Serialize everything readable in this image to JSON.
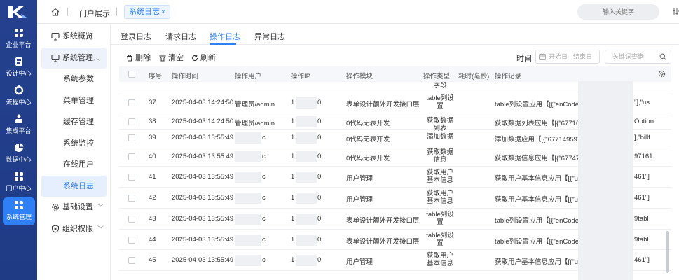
{
  "rail": {
    "items": [
      {
        "label": "企业平台",
        "icon": "grid-icon"
      },
      {
        "label": "设计中心",
        "icon": "design-icon"
      },
      {
        "label": "流程中心",
        "icon": "flow-icon"
      },
      {
        "label": "集成平台",
        "icon": "integration-icon"
      },
      {
        "label": "数据中心",
        "icon": "pie-icon"
      },
      {
        "label": "门户中心",
        "icon": "portal-icon"
      },
      {
        "label": "系统管理",
        "icon": "system-icon"
      }
    ]
  },
  "topbar": {
    "portal_tab": "门户展示",
    "active_tab": "系统日志",
    "close_glyph": "×",
    "search_placeholder": "输入关键字"
  },
  "sidebar": {
    "overview": "系统概览",
    "manage": "系统管理",
    "sub": [
      "系统参数",
      "菜单管理",
      "缓存管理",
      "系统监控",
      "在线用户",
      "系统日志"
    ],
    "basic": "基础设置",
    "org": "组织权限"
  },
  "tabs": [
    "登录日志",
    "请求日志",
    "操作日志",
    "异常日志"
  ],
  "active_tab_index": 2,
  "toolbar": {
    "delete": "删除",
    "clear": "清空",
    "refresh": "刷新",
    "time_label": "时间:",
    "date_placeholder": "开始日 - 结束日",
    "keyword_placeholder": "关键词查询"
  },
  "table": {
    "headers": [
      "序号",
      "操作时间",
      "操作用户",
      "操作IP",
      "操作模块",
      "操作类型",
      "耗时(毫秒)",
      "操作记录"
    ],
    "partial_top_type": "字段",
    "rows": [
      {
        "no": "37",
        "time": "2025-04-03 14:24:50",
        "user": "管理员/admin",
        "ip_a": "1",
        "ip_b": "0",
        "module": "表单设计额外开发接口层",
        "type": "table列设置",
        "record_a": "table列设置应用【[{\"enCode\":\"li",
        "record_b": "\"],\"us"
      },
      {
        "no": "38",
        "time": "2025-04-03 14:24:50",
        "user": "管理员/admin",
        "ip_a": "1",
        "ip_b": "0",
        "module": "0代码无表开发",
        "type": "获取数据列表",
        "record_a": "获取数据列表应用【[{\"677167235",
        "record_b": "Option"
      },
      {
        "no": "39",
        "time": "2025-04-03 13:55:49",
        "user": "",
        "user_tail": "c",
        "ip_a": "1",
        "ip_b": "0",
        "module": "0代码无表开发",
        "type": "添加数据",
        "record_a": "添加数据应用【[{\"6771495971635",
        "record_b": "],\"billf"
      },
      {
        "no": "40",
        "time": "2025-04-03 13:55:49",
        "user": "",
        "user_tail": "c",
        "ip_a": "1",
        "ip_b": "0",
        "module": "0代码无表开发",
        "type": "获取数据信息",
        "record_a": "获取数据信息应用【[{\"67747802",
        "record_b": "97161"
      },
      {
        "no": "41",
        "time": "2025-04-03 13:55:49",
        "user": "",
        "user_tail": "c",
        "ip_a": "1",
        "ip_b": "0",
        "module": "用户管理",
        "type": "获取用户基本信息",
        "record_a": "获取用户基本信息应用【[{\"userI",
        "record_b": "461\"]"
      },
      {
        "no": "42",
        "time": "2025-04-03 13:55:49",
        "user": "",
        "user_tail": "c",
        "ip_a": "1",
        "ip_b": "0",
        "module": "用户管理",
        "type": "获取用户基本信息",
        "record_a": "获取用户基本信息应用【[{\"userI",
        "record_b": "461\"]"
      },
      {
        "no": "43",
        "time": "2025-04-03 13:55:49",
        "user": "",
        "user_tail": "c",
        "ip_a": "1",
        "ip_b": "0",
        "module": "表单设计额外开发接口层",
        "type": "table列设置",
        "record_a": "table列设置应用【[{\"enCode\":\"e",
        "record_b": "9tabl"
      },
      {
        "no": "44",
        "time": "2025-04-03 13:55:49",
        "user": "",
        "user_tail": "c",
        "ip_a": "1",
        "ip_b": "0",
        "module": "表单设计额外开发接口层",
        "type": "table列设置",
        "record_a": "table列设置应用【[{\"enCode\":\"e",
        "record_b": "9tabl"
      },
      {
        "no": "45",
        "time": "2025-04-03 13:55:49",
        "user": "",
        "user_tail": "c",
        "ip_a": "1",
        "ip_b": "0",
        "module": "用户管理",
        "type": "获取用户基本信息",
        "record_a": "获取用户基本信息应用【[{\"userI",
        "record_b": "461\"]"
      }
    ]
  },
  "colors": {
    "accent": "#2f7ff5",
    "rail": "#1f3b86"
  }
}
